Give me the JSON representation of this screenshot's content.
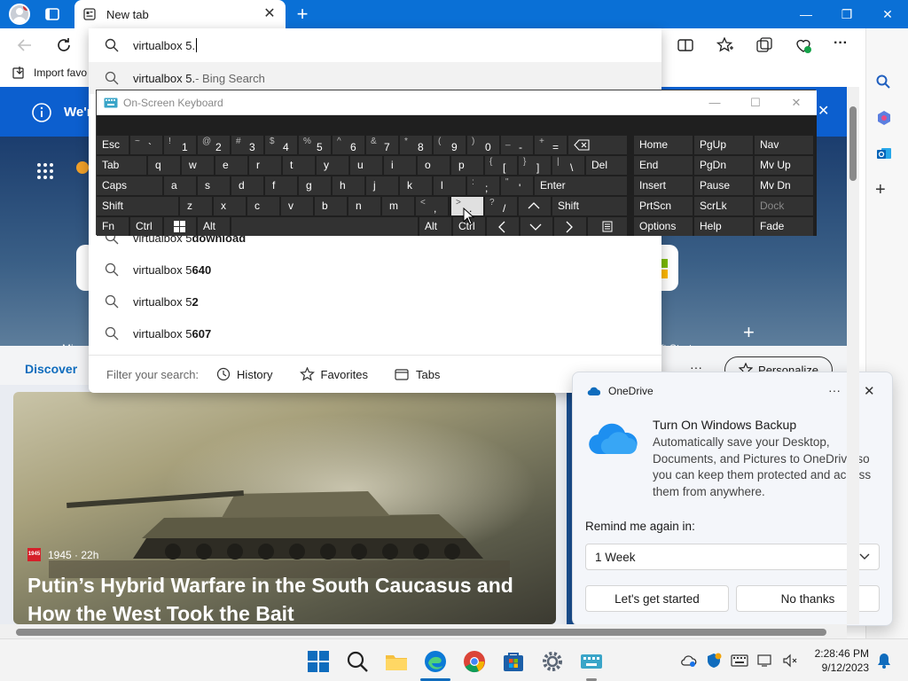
{
  "browser": {
    "tab_title": "New tab",
    "address_value": "virtualbox 5.",
    "favorites_import_label": "Import favo"
  },
  "suggestions": [
    {
      "prefix": "virtualbox 5.",
      "suffix": "",
      "hint": " - Bing Search"
    },
    {
      "prefix": "virtualbox 5 ",
      "suffix": "download",
      "hint": ""
    },
    {
      "prefix": "virtualbox 5",
      "suffix": "640",
      "hint": ""
    },
    {
      "prefix": "virtualbox 5 ",
      "suffix": "2",
      "hint": ""
    },
    {
      "prefix": "virtualbox 5",
      "suffix": "607",
      "hint": ""
    }
  ],
  "filter": {
    "label": "Filter your search:",
    "history": "History",
    "favorites": "Favorites",
    "tabs": "Tabs"
  },
  "page": {
    "banner_text": "We'r",
    "tile_label_left": "Micro",
    "tile_label_right": "ft Start",
    "discover_tab": "Discover",
    "personalize_button": "Personalize",
    "news": {
      "publisher": "1945",
      "badge": "1945",
      "age": "1945 · 22h",
      "headline": "Putin’s Hybrid Warfare in the South Caucasus and How the West Took the Bait"
    }
  },
  "osk": {
    "title": "On-Screen Keyboard",
    "keys": {
      "esc": "Esc",
      "tab": "Tab",
      "caps": "Caps",
      "shift": "Shift",
      "shift_r": "Shift",
      "fn": "Fn",
      "ctrl": "Ctrl",
      "alt": "Alt",
      "alt_r": "Alt",
      "ctrl_r": "Ctrl",
      "del": "Del",
      "enter": "Enter",
      "home": "Home",
      "pgup": "PgUp",
      "nav": "Nav",
      "end": "End",
      "pgdn": "PgDn",
      "mvup": "Mv Up",
      "insert": "Insert",
      "pause": "Pause",
      "mvdn": "Mv Dn",
      "prtscn": "PrtScn",
      "scrlk": "ScrLk",
      "dock": "Dock",
      "options": "Options",
      "help": "Help",
      "fade": "Fade",
      "q": "q",
      "w": "w",
      "e": "e",
      "r": "r",
      "t": "t",
      "y": "y",
      "u": "u",
      "i": "i",
      "o": "o",
      "p": "p",
      "a": "a",
      "s": "s",
      "d": "d",
      "f": "f",
      "g": "g",
      "h": "h",
      "j": "j",
      "k": "k",
      "l": "l",
      "z": "z",
      "x": "x",
      "c": "c",
      "v": "v",
      "b": "b",
      "n": "n",
      "m": "m"
    },
    "number_row": [
      {
        "shift": "~",
        "main": "`"
      },
      {
        "shift": "!",
        "main": "1"
      },
      {
        "shift": "@",
        "main": "2"
      },
      {
        "shift": "#",
        "main": "3"
      },
      {
        "shift": "$",
        "main": "4"
      },
      {
        "shift": "%",
        "main": "5"
      },
      {
        "shift": "^",
        "main": "6"
      },
      {
        "shift": "&",
        "main": "7"
      },
      {
        "shift": "*",
        "main": "8"
      },
      {
        "shift": "(",
        "main": "9"
      },
      {
        "shift": ")",
        "main": "0"
      },
      {
        "shift": "_",
        "main": "-"
      },
      {
        "shift": "+",
        "main": "="
      }
    ],
    "punct": {
      "lbrace": "{",
      "lbracket": "[",
      "rbrace": "}",
      "rbracket": "]",
      "pipe": "|",
      "backslash": "\\",
      "colon": ":",
      "semicolon": ";",
      "quote2": "\"",
      "quote1": "'",
      "lt": "<",
      "comma": ",",
      "gt": ">",
      "period": ".",
      "question": "?",
      "slash": "/"
    }
  },
  "onedrive": {
    "app_name": "OneDrive",
    "title": "Turn On Windows Backup",
    "body": "Automatically save your Desktop, Documents, and Pictures to OneDrive so you can keep them protected and access them from anywhere.",
    "remind_label": "Remind me again in:",
    "remind_value": "1 Week",
    "primary_button": "Let's get started",
    "secondary_button": "No thanks"
  },
  "taskbar": {
    "time": "2:28:46 PM",
    "date": "9/12/2023"
  },
  "colors": {
    "titlebar": "#0a70d6",
    "banner": "#0c5fcf",
    "accent": "#0f6cbd"
  }
}
